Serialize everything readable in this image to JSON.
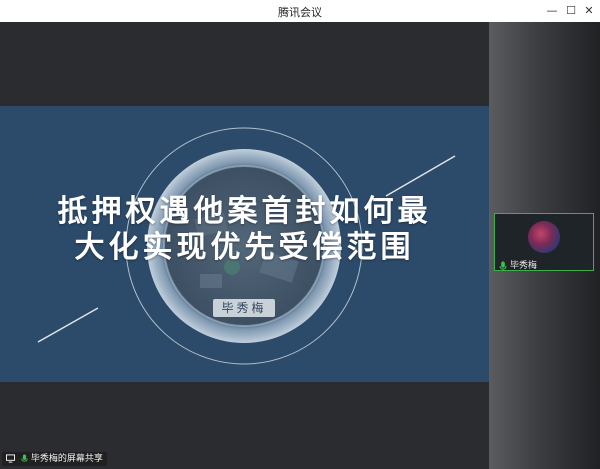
{
  "window": {
    "title": "腾讯会议",
    "minimize_glyph": "—",
    "maximize_glyph": "☐",
    "close_glyph": "✕"
  },
  "slide": {
    "title_line1": "抵押权遇他案首封如何最",
    "title_line2": "大化实现优先受偿范围",
    "author": "毕秀梅"
  },
  "participant": {
    "name": "毕秀梅",
    "icons": [
      "mic-icon"
    ]
  },
  "share_status": {
    "text": "毕秀梅的屏幕共享",
    "icons": [
      "screen-share-icon",
      "mic-icon"
    ]
  },
  "colors": {
    "slide_bg": "#2c4a69",
    "active_speaker_border": "#3fae4e",
    "mic_green": "#3fbf52"
  }
}
